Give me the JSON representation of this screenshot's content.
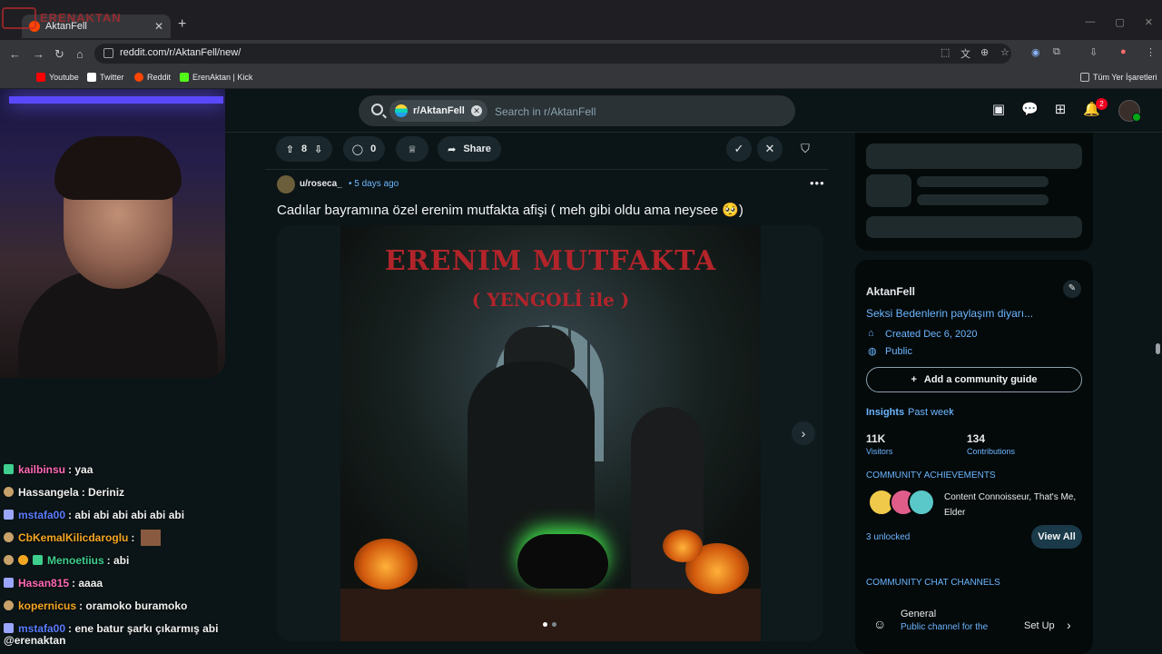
{
  "browser": {
    "tab_title": "AktanFell",
    "url": "reddit.com/r/AktanFell/new/",
    "bookmarks": [
      {
        "label": "Youtube",
        "color": "#ff0000"
      },
      {
        "label": "Twitter",
        "color": "#ffffff"
      },
      {
        "label": "Reddit",
        "color": "#ff4500"
      },
      {
        "label": "ErenAktan | Kick",
        "color": "#53fc18"
      }
    ],
    "bookmarks_folder": "Tüm Yer İşaretleri"
  },
  "header": {
    "community_chip": "r/AktanFell",
    "search_placeholder": "Search in r/AktanFell",
    "notification_count": "2"
  },
  "post": {
    "upvotes": "8",
    "comments": "0",
    "share_label": "Share",
    "author": "u/roseca_",
    "time": "• 5 days ago",
    "title": "Cadılar bayramına özel erenim mutfakta afişi ( meh gibi oldu ama neysee 🥺)",
    "image_title": "ERENIM MUTFAKTA",
    "image_subtitle": "( YENGOLİ ile )"
  },
  "sidebar": {
    "community_name": "AktanFell",
    "description": "Seksi Bedenlerin paylaşım diyarı...",
    "created": "Created Dec 6, 2020",
    "visibility": "Public",
    "guide_button": "Add a community guide",
    "insights_label": "Insights",
    "insights_range": "Past week",
    "visitors_value": "11K",
    "visitors_label": "Visitors",
    "contributions_value": "134",
    "contributions_label": "Contributions",
    "achievements_heading": "COMMUNITY ACHIEVEMENTS",
    "achievements_text": "Content Connoisseur, That's Me, Elder",
    "unlocked": "3 unlocked",
    "view_all": "View All",
    "chat_heading": "COMMUNITY CHAT CHANNELS",
    "chat_name": "General",
    "chat_desc": "Public channel for the",
    "setup_label": "Set Up"
  },
  "stream": {
    "chat": [
      {
        "user": "kailbinsu",
        "msg": ": yaa",
        "color": "#ff69b4"
      },
      {
        "user": "Hassangela",
        "msg": ": Deriniz",
        "color": "#f0f0f0"
      },
      {
        "user": "mstafa00",
        "msg": ": abi abi abi abi abi abi",
        "color": "#5b7cff"
      },
      {
        "user": "CbKemalKilicdaroglu",
        "msg": ":",
        "color": "#f5a623"
      },
      {
        "user": "Menoetiius",
        "msg": ": abi",
        "color": "#3ecf8e"
      },
      {
        "user": "Hasan815",
        "msg": ": aaaa",
        "color": "#ff69b4"
      },
      {
        "user": "kopernicus",
        "msg": ": oramoko buramoko",
        "color": "#f5a623"
      },
      {
        "user": "mstafa00",
        "msg": ": ene batur şarkı çıkarmış abi",
        "color": "#5b7cff"
      }
    ],
    "streamer_handle": "@erenaktan",
    "logo_text": "ERENAKTAN"
  }
}
